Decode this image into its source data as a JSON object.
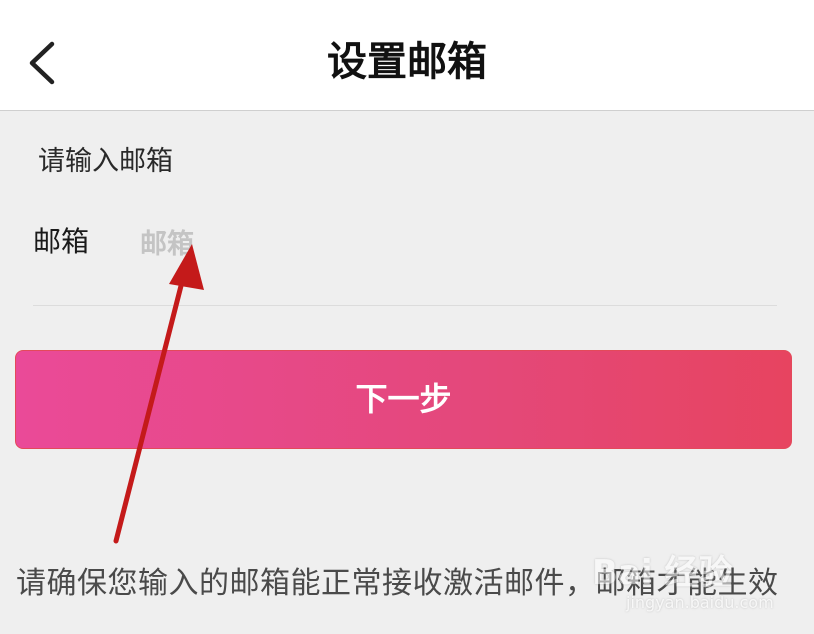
{
  "header": {
    "title": "设置邮箱",
    "back_icon": "chevron-left-icon"
  },
  "form": {
    "prompt": "请输入邮箱",
    "email_label": "邮箱",
    "email_placeholder": "邮箱",
    "email_value": ""
  },
  "next_button": {
    "label": "下一步"
  },
  "notice": {
    "text": "请确保您输入的邮箱能正常接收激活邮件，邮箱才能生效"
  },
  "watermark": {
    "logo": "Bai 经验",
    "url": "jingyan.baidu.com"
  },
  "colors": {
    "header_bg": "#ffffff",
    "page_bg": "#efefef",
    "button_gradient_start": "#ea4a98",
    "button_gradient_end": "#e74460",
    "annotation_arrow": "#c41a1a"
  }
}
